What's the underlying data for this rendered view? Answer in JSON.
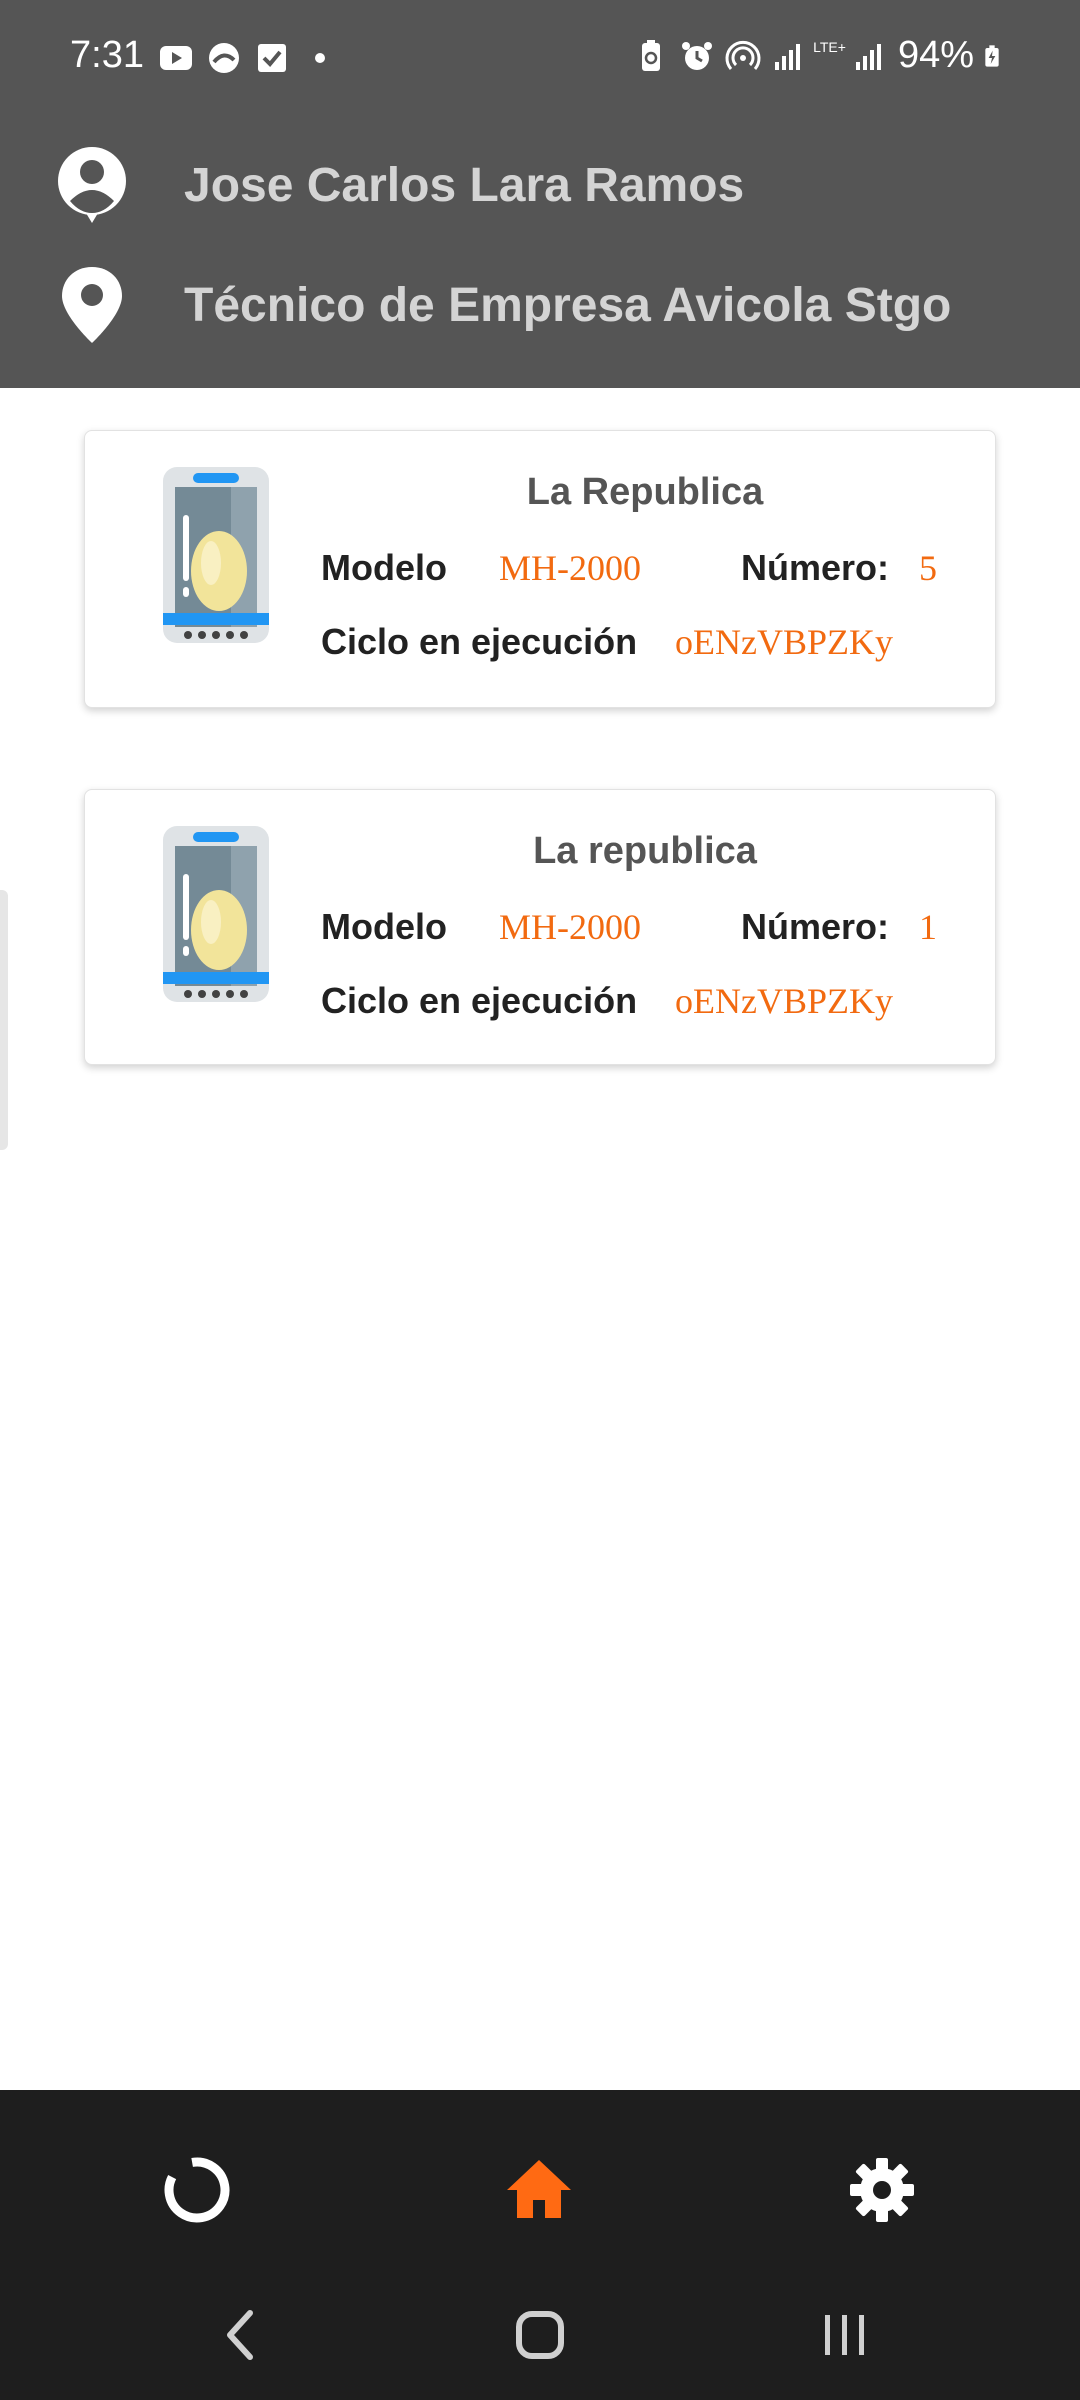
{
  "status_bar": {
    "time": "7:31",
    "battery": "94%",
    "network": "LTE+"
  },
  "header": {
    "user_name": "Jose Carlos Lara Ramos",
    "user_role": "Técnico de Empresa Avicola Stgo"
  },
  "cards": [
    {
      "title": "La Republica",
      "modelo_label": "Modelo",
      "modelo_value": "MH-2000",
      "numero_label": "Número:",
      "numero_value": "5",
      "ciclo_label": "Ciclo en ejecución",
      "ciclo_value": "oENzVBPZKy"
    },
    {
      "title": "La republica",
      "modelo_label": "Modelo",
      "modelo_value": "MH-2000",
      "numero_label": "Número:",
      "numero_value": "1",
      "ciclo_label": "Ciclo en ejecución",
      "ciclo_value": "oENzVBPZKy"
    }
  ],
  "colors": {
    "header_bg": "#555555",
    "accent": "#f26a10",
    "nav_bg": "#1e1e1e"
  },
  "nav": {
    "items": [
      "loading-icon",
      "home-icon",
      "settings-icon"
    ],
    "active": "home-icon"
  }
}
